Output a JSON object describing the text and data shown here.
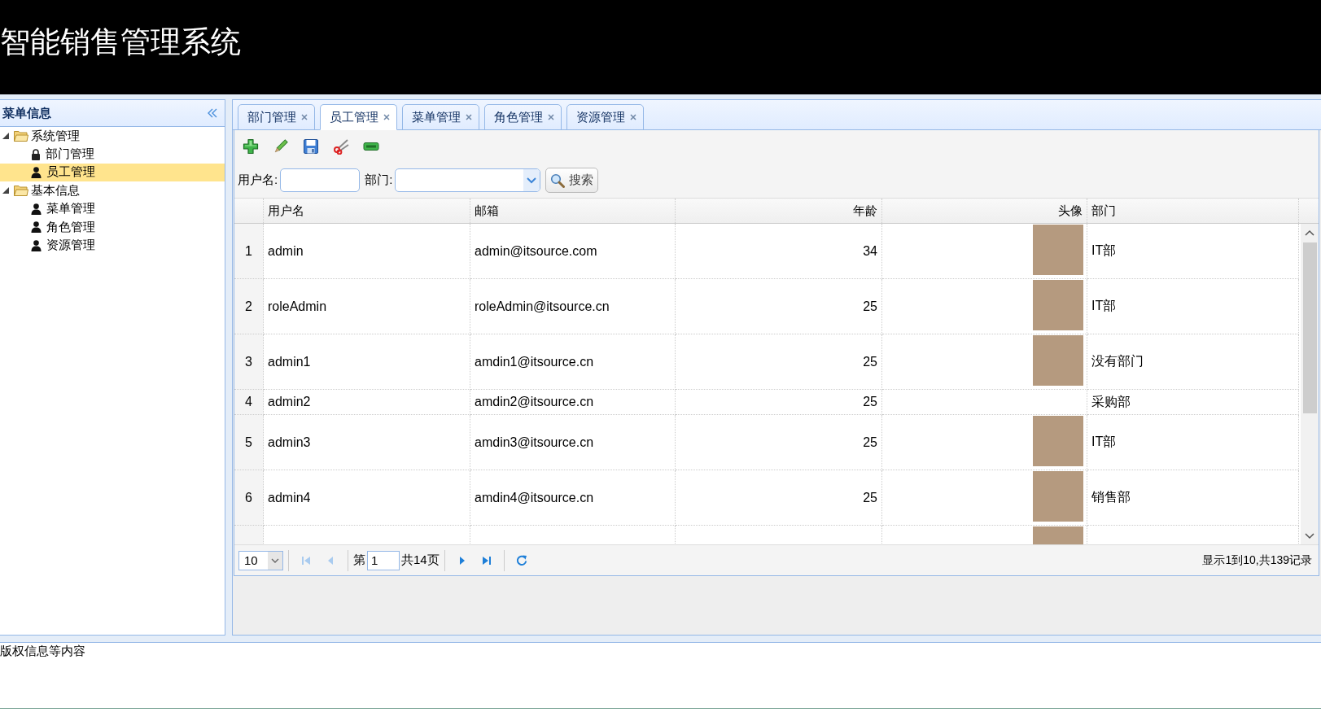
{
  "header": {
    "title": "智能销售管理系统"
  },
  "sidebar": {
    "title": "菜单信息",
    "tree": [
      {
        "label": "系统管理",
        "expanded": true,
        "selected": false,
        "children": [
          {
            "label": "部门管理",
            "kind": "locked",
            "selected": false
          },
          {
            "label": "员工管理",
            "kind": "user",
            "selected": true
          }
        ]
      },
      {
        "label": "基本信息",
        "expanded": true,
        "selected": false,
        "children": [
          {
            "label": "菜单管理",
            "kind": "user",
            "selected": false
          },
          {
            "label": "角色管理",
            "kind": "user",
            "selected": false
          },
          {
            "label": "资源管理",
            "kind": "user",
            "selected": false
          }
        ]
      }
    ]
  },
  "tabs": [
    {
      "label": "部门管理",
      "selected": false
    },
    {
      "label": "员工管理",
      "selected": true
    },
    {
      "label": "菜单管理",
      "selected": false
    },
    {
      "label": "角色管理",
      "selected": false
    },
    {
      "label": "资源管理",
      "selected": false
    }
  ],
  "search": {
    "fields": [
      {
        "label": "用户名:",
        "kind": "text"
      },
      {
        "label": "部门:",
        "kind": "select"
      }
    ],
    "button": "搜索"
  },
  "table": {
    "columns": [
      {
        "label": "用户名",
        "kind": "text"
      },
      {
        "label": "邮箱",
        "kind": "text"
      },
      {
        "label": "年龄",
        "kind": "number"
      },
      {
        "label": "头像",
        "kind": "image"
      },
      {
        "label": "部门",
        "kind": "text"
      }
    ],
    "rows": [
      {
        "number": "1",
        "cells": [
          "admin",
          "admin@itsource.com",
          "34",
          true,
          "IT部"
        ]
      },
      {
        "number": "2",
        "cells": [
          "roleAdmin",
          "roleAdmin@itsource.cn",
          "25",
          true,
          "IT部"
        ]
      },
      {
        "number": "3",
        "cells": [
          "admin1",
          "amdin1@itsource.cn",
          "25",
          true,
          "没有部门"
        ]
      },
      {
        "number": "4",
        "cells": [
          "admin2",
          "amdin2@itsource.cn",
          "25",
          false,
          "采购部"
        ]
      },
      {
        "number": "5",
        "cells": [
          "admin3",
          "amdin3@itsource.cn",
          "25",
          true,
          "IT部"
        ]
      },
      {
        "number": "6",
        "cells": [
          "admin4",
          "amdin4@itsource.cn",
          "25",
          true,
          "销售部"
        ]
      },
      {
        "cells": [
          null,
          null,
          null,
          true,
          null
        ]
      }
    ]
  },
  "pager": {
    "page_size": "10",
    "first": {
      "disabled": true
    },
    "prev": {
      "disabled": true
    },
    "page_prefix": "第",
    "page": "1",
    "page_suffix": "共14页",
    "next": {
      "disabled": false
    },
    "last": {
      "disabled": false
    },
    "info": "显示1到10,共139记录"
  },
  "footer": {
    "text": "版权信息等内容"
  }
}
